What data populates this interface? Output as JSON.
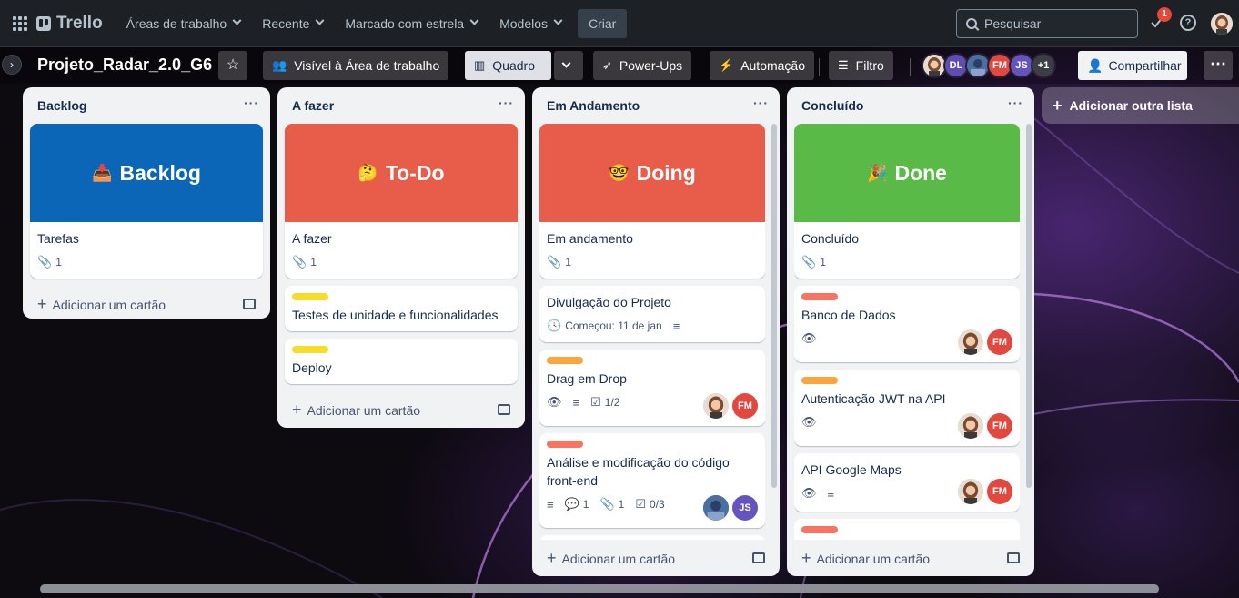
{
  "topbar": {
    "logo": "Trello",
    "nav": [
      "Áreas de trabalho",
      "Recente",
      "Marcado com estrela",
      "Modelos"
    ],
    "create": "Criar",
    "search_placeholder": "Pesquisar",
    "notification_count": "1"
  },
  "board": {
    "title": "Projeto_Radar_2.0_G6",
    "visibility": "Visível à Área de trabalho",
    "view": "Quadro",
    "powerups": "Power-Ups",
    "automation": "Automação",
    "filter": "Filtro",
    "members": [
      {
        "initials": "",
        "color": "#d8c4b4",
        "photo": true
      },
      {
        "initials": "DL",
        "color": "#5e4db2"
      },
      {
        "initials": "",
        "color": "#3a6ea5",
        "photo": true
      },
      {
        "initials": "FM",
        "color": "#e2483d"
      },
      {
        "initials": "JS",
        "color": "#6554c0"
      }
    ],
    "extra_members": "+1",
    "share": "Compartilhar"
  },
  "add_card_label": "Adicionar um cartão",
  "add_list_label": "Adicionar outra lista",
  "lists": [
    {
      "title": "Backlog",
      "cover": {
        "emoji": "📥",
        "text": "Backlog",
        "color": "#0c66b8"
      },
      "cover_card": {
        "title": "Tarefas",
        "attachments": "1"
      }
    },
    {
      "title": "A fazer",
      "cover": {
        "emoji": "🤔",
        "text": "To-Do",
        "color": "#e85c4a"
      },
      "cover_card": {
        "title": "A fazer",
        "attachments": "1"
      },
      "cards": [
        {
          "title": "Testes de unidade e funcionalidades",
          "label_color": "#f5dd29"
        },
        {
          "title": "Deploy",
          "label_color": "#f5dd29"
        }
      ]
    },
    {
      "title": "Em Andamento",
      "cover": {
        "emoji": "🤓",
        "text": "Doing",
        "color": "#e85c4a"
      },
      "cover_card": {
        "title": "Em andamento",
        "attachments": "1"
      },
      "cards": [
        {
          "title": "Divulgação do Projeto",
          "date": "Começou: 11 de jan"
        },
        {
          "title": "Drag em Drop",
          "label_color": "#faa53d",
          "checklist": "1/2"
        },
        {
          "title": "Análise e modificação do código front-end",
          "label_color": "#f87462",
          "comments": "1",
          "attachments": "1",
          "checklist": "0/3"
        }
      ]
    },
    {
      "title": "Concluído",
      "cover": {
        "emoji": "🎉",
        "text": "Done",
        "color": "#5aba47"
      },
      "cover_card": {
        "title": "Concluído",
        "attachments": "1"
      },
      "cards": [
        {
          "title": "Banco de Dados",
          "label_color": "#f87462"
        },
        {
          "title": "Autenticação JWT na API",
          "label_color": "#faa53d"
        },
        {
          "title": "API Google Maps"
        }
      ]
    }
  ]
}
